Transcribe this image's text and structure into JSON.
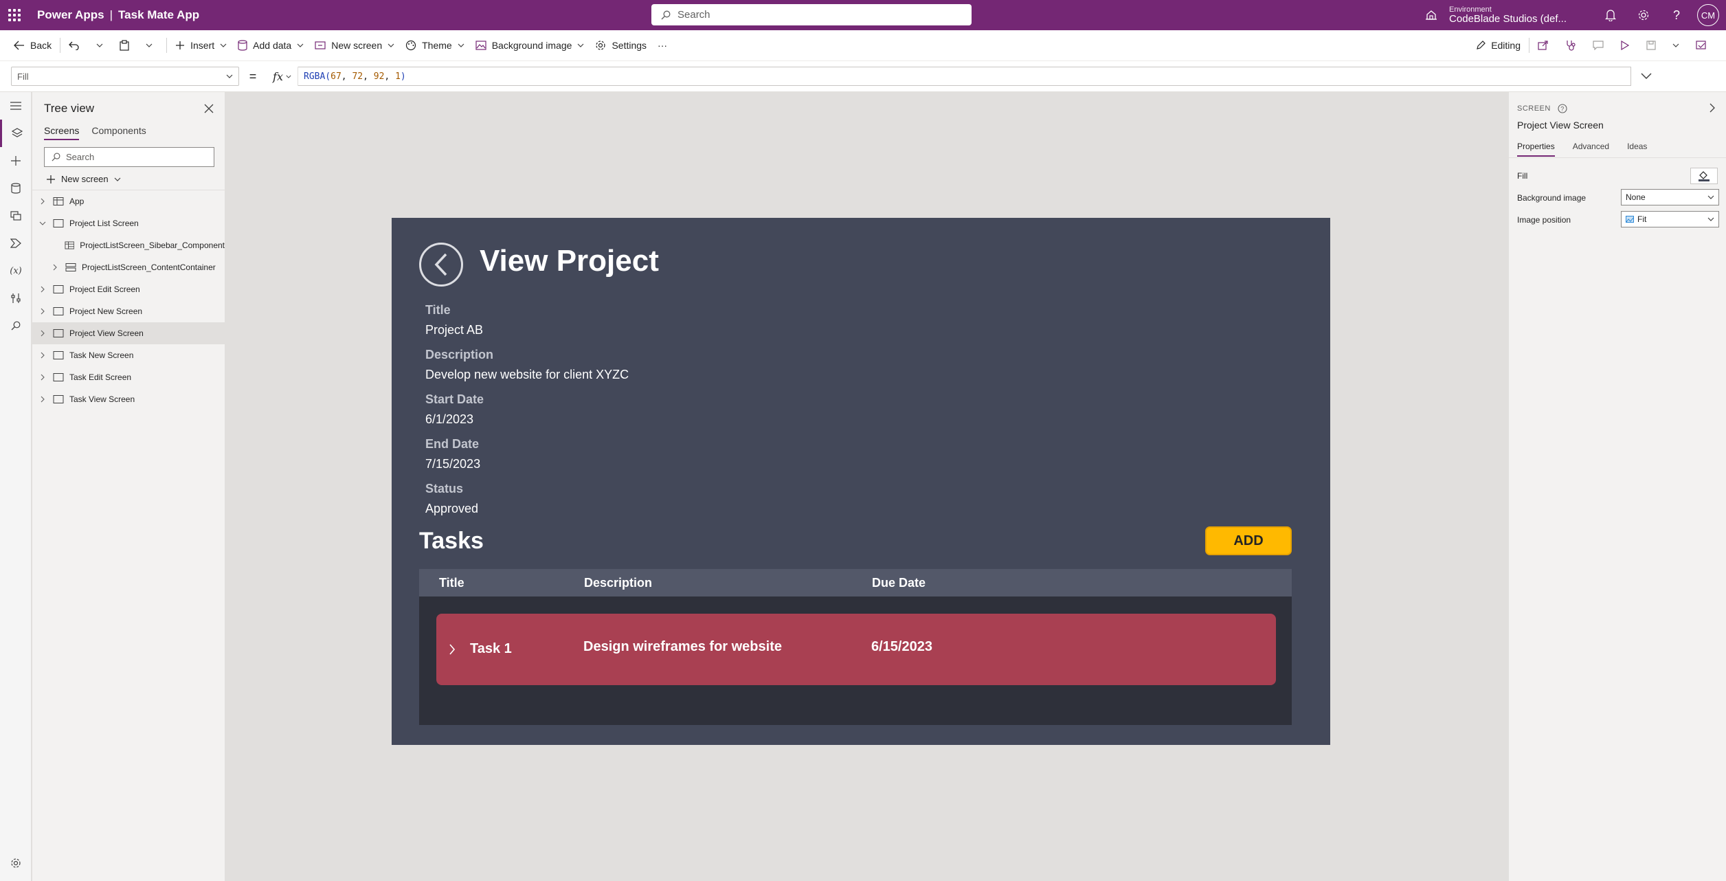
{
  "topbar": {
    "product": "Power Apps",
    "separator": "|",
    "app_name": "Task Mate App",
    "search_placeholder": "Search",
    "environment_label": "Environment",
    "environment_name": "CodeBlade Studios (def...",
    "user_initials": "CM"
  },
  "commandbar": {
    "back": "Back",
    "insert": "Insert",
    "add_data": "Add data",
    "new_screen": "New screen",
    "theme": "Theme",
    "background_image": "Background image",
    "settings": "Settings",
    "more": "···",
    "editing": "Editing"
  },
  "formulabar": {
    "property": "Fill",
    "equals": "=",
    "fx": "fx",
    "formula_fn": "RGBA(",
    "formula_args": [
      "67",
      "72",
      "92",
      "1"
    ],
    "formula_close": ")"
  },
  "tree": {
    "title": "Tree view",
    "tabs": [
      "Screens",
      "Components"
    ],
    "search_placeholder": "Search",
    "new_screen": "New screen",
    "items": [
      {
        "label": "App"
      },
      {
        "label": "Project List Screen"
      },
      {
        "label": "ProjectListScreen_Sibebar_Component"
      },
      {
        "label": "ProjectListScreen_ContentContainer"
      },
      {
        "label": "Project Edit Screen"
      },
      {
        "label": "Project New Screen"
      },
      {
        "label": "Project View Screen"
      },
      {
        "label": "Task New Screen"
      },
      {
        "label": "Task Edit Screen"
      },
      {
        "label": "Task View Screen"
      }
    ]
  },
  "screen": {
    "fill_color": "#434859",
    "title": "View Project",
    "fields": [
      {
        "label": "Title",
        "value": "Project AB"
      },
      {
        "label": "Description",
        "value": "Develop new website for client XYZC"
      },
      {
        "label": "Start Date",
        "value": "6/1/2023"
      },
      {
        "label": "End Date",
        "value": "7/15/2023"
      },
      {
        "label": "Status",
        "value": "Approved"
      }
    ],
    "tasks_title": "Tasks",
    "add_button": "ADD",
    "accent_color": "#ffb900",
    "table_headers": [
      "Title",
      "Description",
      "Due Date"
    ],
    "tasks": [
      {
        "title": "Task 1",
        "description": "Design wireframes for website",
        "due": "6/15/2023"
      }
    ]
  },
  "properties": {
    "kind": "SCREEN",
    "name": "Project View Screen",
    "tabs": [
      "Properties",
      "Advanced",
      "Ideas"
    ],
    "fill_label": "Fill",
    "bg_image_label": "Background image",
    "bg_image_value": "None",
    "image_position_label": "Image position",
    "image_position_value": "Fit"
  }
}
